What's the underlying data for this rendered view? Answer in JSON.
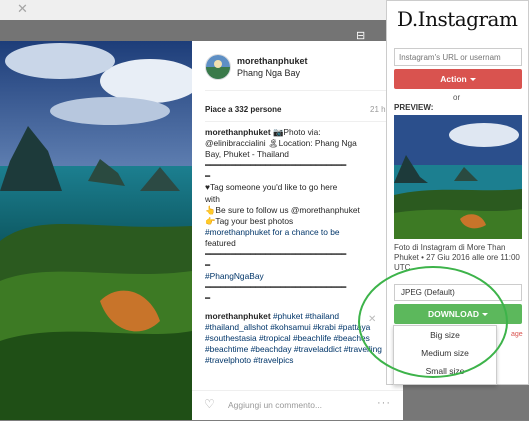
{
  "post": {
    "username": "morethanphuket",
    "location": "Phang Nga Bay",
    "likes": "Piace a 332 persone",
    "age": "21 h",
    "caption_lines": [
      "@elinibraccialini 🏝Location: Phang Nga",
      "Bay, Phuket - Thailand",
      "━━━━━━━━━━━━━━━━━━━━━━━━━━━━",
      "━",
      "♥Tag someone you'd like to go here",
      "with",
      "👆Be sure to follow us @morethanphuket",
      "👉Tag your best photos",
      "#morethanphuket for a chance to be",
      "featured",
      "━━━━━━━━━━━━━━━━━━━━━━━━━━━━",
      "━",
      "#PhangNgaBay",
      "━━━━━━━━━━━━━━━━━━━━━━━━━━━━",
      "━"
    ],
    "caption_intro": "📷Photo via:",
    "comment_user": "morethanphuket",
    "comment_tags": "#phuket #thailand #thailand_allshot #kohsamui #krabi #pattaya #southestasia #tropical #beachlife #beaches #beachtime #beachday #traveladdict #travelling #travelphoto #travelpics",
    "comment_placeholder": "Aggiungi un commento...",
    "more": "···"
  },
  "extension": {
    "logo": "D.Instagram",
    "url_placeholder": "Instagram's URL or usernam",
    "action_label": "Action",
    "or_label": "or",
    "preview_label": "PREVIEW:",
    "meta_text": "Foto di Instagram di More Than Phuket • 27 Giu 2016 alle ore 11:00 UTC",
    "format_value": "JPEG (Default)",
    "download_label": "DOWNLOAD",
    "red_fragment": "age",
    "menu_options": [
      "Big size",
      "Medium size",
      "Small size"
    ]
  },
  "colors": {
    "action": "#d9534f",
    "download": "#5cb85c",
    "highlight_circle": "#3db34a",
    "hashtag": "#003569"
  },
  "icons": {
    "close": "close-icon",
    "heart": "heart-icon",
    "more": "more-icon",
    "camera": "camera-icon"
  }
}
